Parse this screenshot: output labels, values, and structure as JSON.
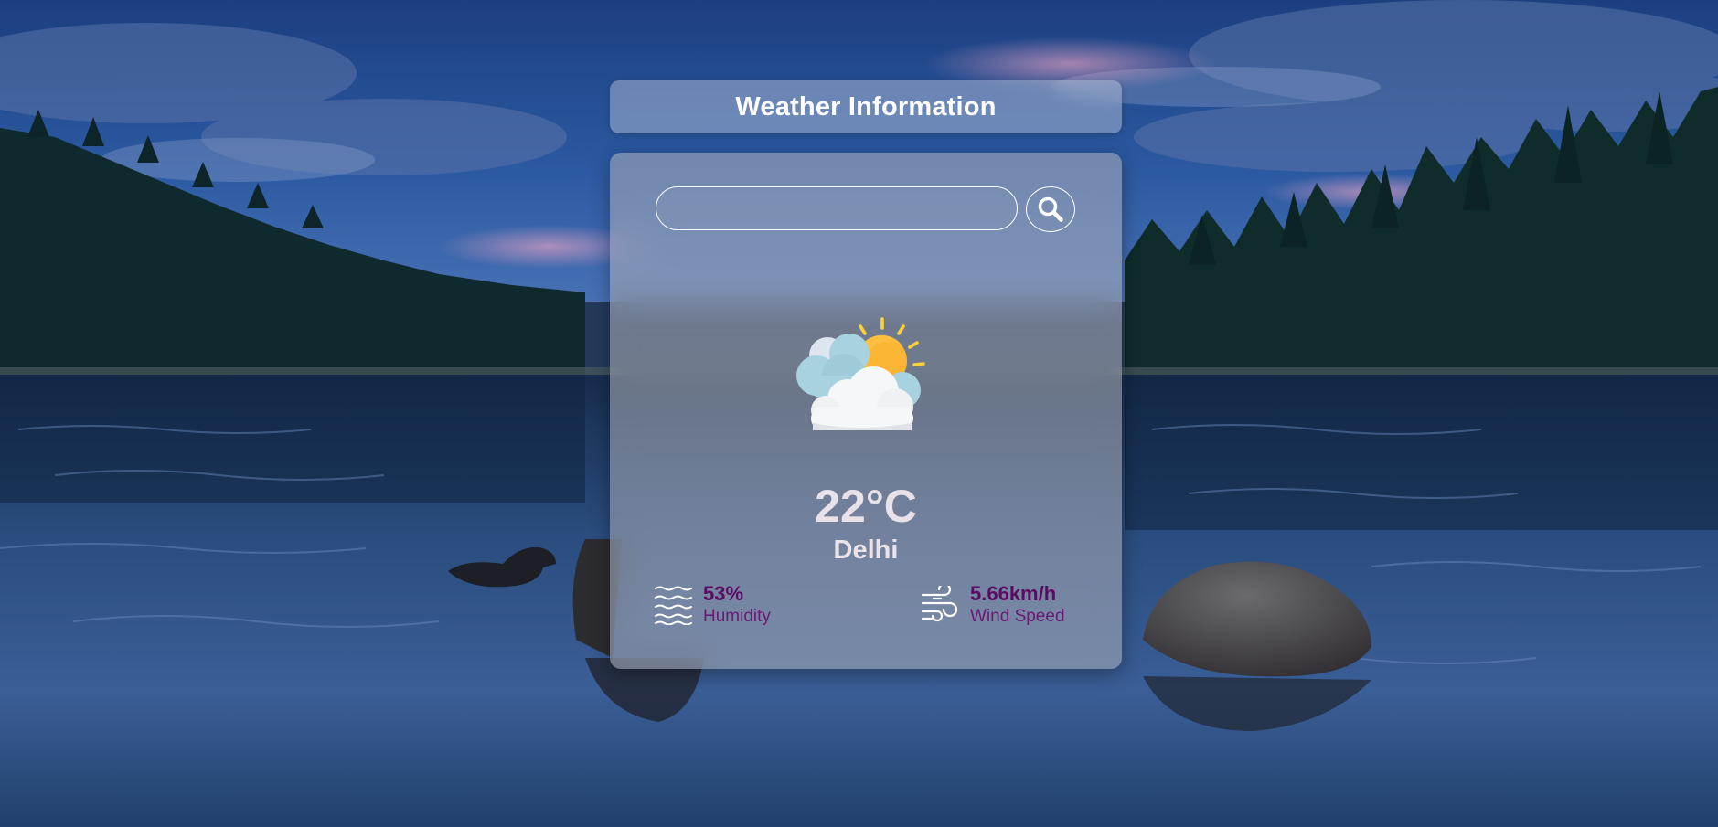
{
  "page": {
    "title": "Weather Information"
  },
  "search": {
    "value": "",
    "placeholder": "",
    "button_icon": "search-icon"
  },
  "weather": {
    "icon": "partly-cloudy-icon",
    "temperature": "22°C",
    "city": "Delhi"
  },
  "humidity": {
    "icon": "humidity-waves-icon",
    "value": "53%",
    "label": "Humidity"
  },
  "wind": {
    "icon": "wind-icon",
    "value": "5.66km/h",
    "label": "Wind Speed"
  },
  "background": {
    "scene": "lake-at-dusk"
  },
  "colors": {
    "stat_value": "#5c0b63",
    "stat_label": "#6a1a73",
    "temperature_text": "#e9e1e8",
    "sun": "#fdb633"
  }
}
